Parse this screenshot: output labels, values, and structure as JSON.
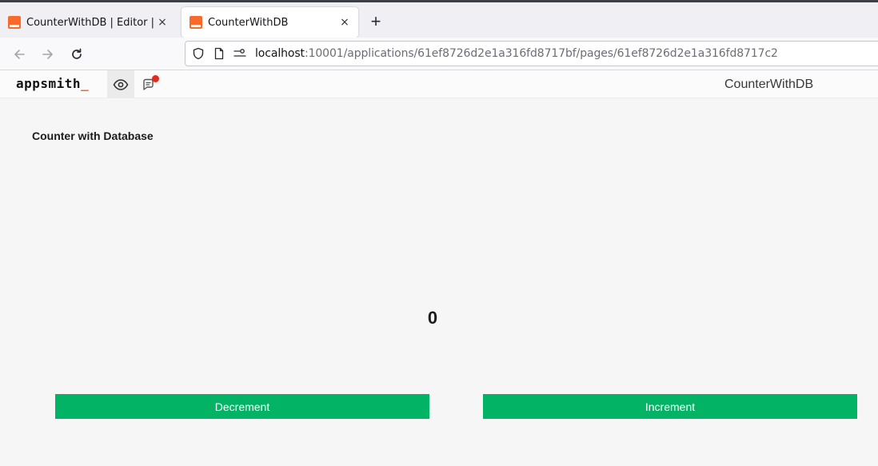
{
  "browser": {
    "tabs": [
      {
        "title": "CounterWithDB | Editor | A",
        "close": "×"
      },
      {
        "title": "CounterWithDB",
        "close": "×"
      }
    ],
    "new_tab": "+",
    "url": {
      "host": "localhost",
      "path": ":10001/applications/61ef8726d2e1a316fd8717bf/pages/61ef8726d2e1a316fd8717c2"
    }
  },
  "app_header": {
    "logo_text": "appsmith",
    "logo_underscore": "_",
    "app_name": "CounterWithDB"
  },
  "canvas": {
    "heading": "Counter with Database",
    "counter_value": "0",
    "decrement_label": "Decrement",
    "increment_label": "Increment"
  },
  "colors": {
    "brand": "#f86a2b",
    "button_green": "#03b365",
    "notification_dot": "#e8281c"
  }
}
